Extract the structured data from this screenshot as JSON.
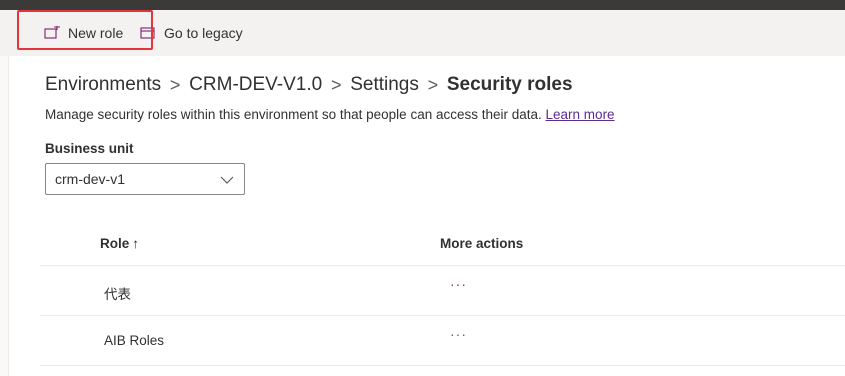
{
  "command_bar": {
    "new_role_label": "New role",
    "go_to_legacy_label": "Go to legacy"
  },
  "breadcrumb": {
    "items": [
      "Environments",
      "CRM-DEV-V1.0",
      "Settings"
    ],
    "current": "Security roles",
    "separator": ">"
  },
  "description": {
    "text": "Manage security roles within this environment so that people can access their data.",
    "link": "Learn more"
  },
  "business_unit": {
    "label": "Business unit",
    "selected": "crm-dev-v1"
  },
  "grid": {
    "columns": {
      "role": "Role",
      "sort_indicator": "↑",
      "more_actions": "More actions"
    },
    "rows": [
      {
        "name": "代表",
        "more": "···"
      },
      {
        "name": "AIB Roles",
        "more": "···"
      }
    ]
  },
  "colors": {
    "highlight": "#e4353e",
    "link": "#5c2d91",
    "accent_more": "#a4262c"
  }
}
